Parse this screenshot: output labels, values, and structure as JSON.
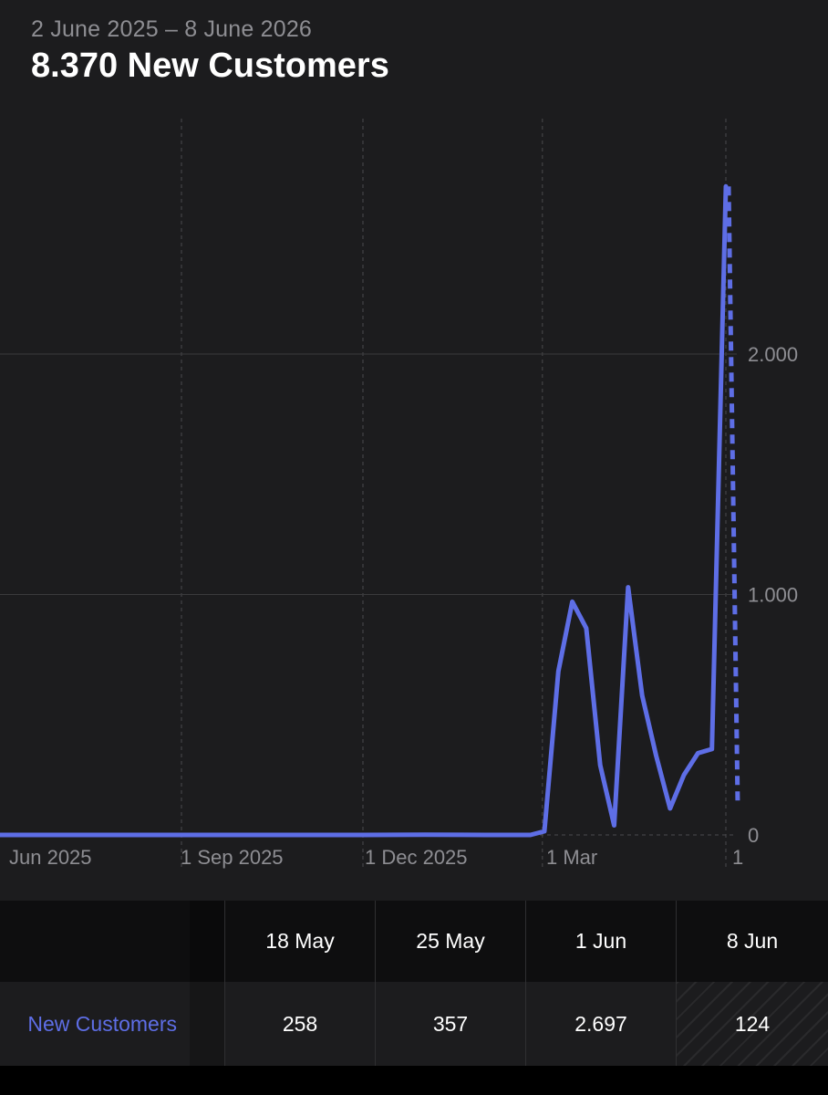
{
  "header": {
    "date_range": "2 June 2025 – 8 June 2026",
    "headline": "8.370 New Customers"
  },
  "colors": {
    "background": "#1c1c1e",
    "line": "#5e6ee6",
    "grid": "#3a3a3c",
    "muted_text": "#8e8e93"
  },
  "chart_data": {
    "type": "line",
    "x_ticks": [
      "Jun 2025",
      "1 Sep 2025",
      "1 Dec 2025",
      "1 Mar",
      "1"
    ],
    "y_ticks": [
      "2.000",
      "1.000",
      "0"
    ],
    "ylim": [
      0,
      2700
    ],
    "series": [
      {
        "values": [
          [
            "2025-06-02",
            0
          ],
          [
            "2025-07-01",
            0
          ],
          [
            "2025-08-01",
            0
          ],
          [
            "2025-09-01",
            0
          ],
          [
            "2025-10-01",
            0
          ],
          [
            "2025-11-01",
            0
          ],
          [
            "2025-12-01",
            0
          ],
          [
            "2026-01-01",
            1
          ],
          [
            "2026-02-01",
            0
          ],
          [
            "2026-02-23",
            0
          ],
          [
            "2026-03-02",
            15
          ],
          [
            "2026-03-09",
            680
          ],
          [
            "2026-03-16",
            970
          ],
          [
            "2026-03-23",
            860
          ],
          [
            "2026-03-30",
            290
          ],
          [
            "2026-04-06",
            40
          ],
          [
            "2026-04-13",
            1030
          ],
          [
            "2026-04-20",
            580
          ],
          [
            "2026-04-27",
            330
          ],
          [
            "2026-05-04",
            110
          ],
          [
            "2026-05-11",
            250
          ],
          [
            "2026-05-18",
            340
          ],
          [
            "2026-05-25",
            357
          ],
          [
            "2026-06-01",
            2697
          ]
        ]
      },
      {
        "style": "dashed",
        "values": [
          [
            "2026-06-01",
            2697
          ],
          [
            "2026-06-08",
            124
          ]
        ]
      }
    ],
    "grid": true,
    "y_axis_position": "right"
  },
  "table": {
    "columns": [
      "18 May",
      "25 May",
      "1 Jun",
      "8 Jun"
    ],
    "row_label": "New Customers",
    "values": [
      "258",
      "357",
      "2.697",
      "124"
    ]
  }
}
